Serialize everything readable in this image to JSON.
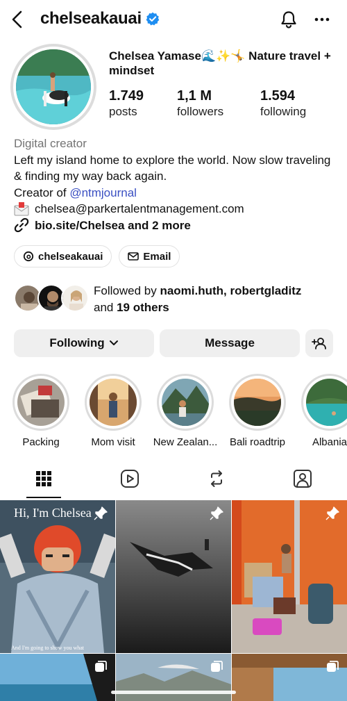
{
  "header": {
    "username": "chelseakauai",
    "verified": true
  },
  "profile": {
    "full_name": "Chelsea Yamase🌊✨🤸 Nature travel + mindset",
    "stats": [
      {
        "value": "1.749",
        "label": "posts"
      },
      {
        "value": "1,1 M",
        "label": "followers"
      },
      {
        "value": "1.594",
        "label": "following"
      }
    ]
  },
  "bio": {
    "category": "Digital creator",
    "line1": "Left my island home to explore the world. Now slow traveling & finding my way back again.",
    "creator_prefix": "Creator of ",
    "creator_handle": "@ntmjournal",
    "email": "chelsea@parkertalentmanagement.com",
    "link": "bio.site/Chelsea and 2 more"
  },
  "chips": {
    "threads": "chelseakauai",
    "email": "Email"
  },
  "followed_by": {
    "prefix": "Followed by ",
    "names": "naomi.huth, robertgladitz",
    "and": "and ",
    "others": "19 others"
  },
  "actions": {
    "following": "Following",
    "message": "Message"
  },
  "highlights": [
    {
      "label": "Packing"
    },
    {
      "label": "Mom visit"
    },
    {
      "label": "New Zealan..."
    },
    {
      "label": "Bali roadtrip"
    },
    {
      "label": "Albania"
    }
  ],
  "posts": {
    "caption_title": "Hi, I'm Chelsea",
    "caption_sub": "And I'm going to show you what"
  },
  "colors": {
    "verified_blue": "#1f8ef1",
    "link_blue": "#3a4fc2",
    "button_gray": "#efefef"
  },
  "icons": [
    "back-arrow-icon",
    "verified-icon",
    "bell-icon",
    "more-icon",
    "link-icon",
    "mail-icon",
    "threads-icon",
    "chevron-down-icon",
    "add-user-icon",
    "grid-icon",
    "reels-icon",
    "reposts-icon",
    "tagged-icon",
    "pin-icon",
    "carousel-icon"
  ]
}
